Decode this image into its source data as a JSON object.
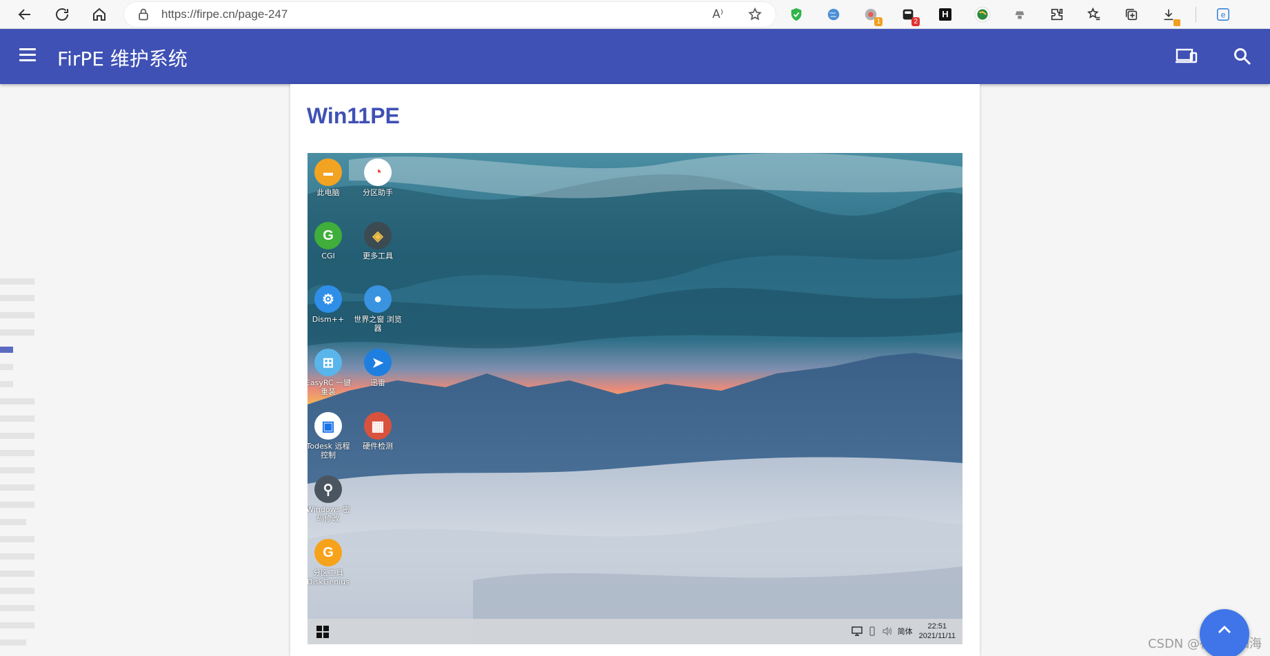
{
  "browser": {
    "url": "https://firpe.cn/page-247",
    "read_aloud": "A⁾",
    "extensions": [
      {
        "name": "shield-extension-icon",
        "badge": ""
      },
      {
        "name": "globe-extension-icon",
        "badge": ""
      },
      {
        "name": "chrome-ball-extension-icon",
        "badge": "1"
      },
      {
        "name": "dark-box-extension-icon",
        "badge": "2"
      },
      {
        "name": "h-extension-icon",
        "badge": "",
        "text": "H"
      },
      {
        "name": "earth-extension-icon",
        "badge": ""
      },
      {
        "name": "hat-extension-icon",
        "badge": ""
      },
      {
        "name": "puzzle-extensions-icon",
        "badge": ""
      },
      {
        "name": "favorites-icon",
        "badge": ""
      },
      {
        "name": "collections-icon",
        "badge": ""
      },
      {
        "name": "downloads-icon",
        "badge": ""
      },
      {
        "name": "edge-icon",
        "badge": ""
      }
    ],
    "badge_colors": {
      "orange": "#f0a020",
      "red": "#e03030"
    }
  },
  "appbar": {
    "title": "FirPE 维护系统",
    "color": "#3f51b5"
  },
  "article": {
    "title": "Win11PE"
  },
  "desktop": {
    "icons": [
      {
        "label": "此电脑",
        "color": "#f3a322",
        "glyph": "▬"
      },
      {
        "label": "分区助手",
        "color": "#ffffff",
        "glyph": "◔"
      },
      {
        "label": "CGI",
        "color": "#3fae3a",
        "glyph": "G"
      },
      {
        "label": "更多工具",
        "color": "#3c4a52",
        "glyph": "◈"
      },
      {
        "label": "Dism++",
        "color": "#2f8fe8",
        "glyph": "⚙"
      },
      {
        "label": "世界之窗 浏览器",
        "color": "#3a93e0",
        "glyph": "●"
      },
      {
        "label": "EasyRC 一键重装",
        "color": "#59b5ea",
        "glyph": "⊞"
      },
      {
        "label": "迅雷",
        "color": "#1e7fe0",
        "glyph": "➤"
      },
      {
        "label": "Todesk 远程控制",
        "color": "#ffffff",
        "glyph": "▣"
      },
      {
        "label": "硬件检测",
        "color": "#d9523d",
        "glyph": "▦"
      },
      {
        "label": "Windows 密码修改",
        "color": "#4a5560",
        "glyph": "⚲"
      },
      {
        "label": "分区工具 DiskGenius",
        "color": "#f7a21b",
        "glyph": "G"
      }
    ],
    "tray": {
      "ime": "简体",
      "time": "22:51",
      "date": "2021/11/11"
    }
  },
  "watermark": "CSDN @夜星空如海",
  "fab_label": "^"
}
